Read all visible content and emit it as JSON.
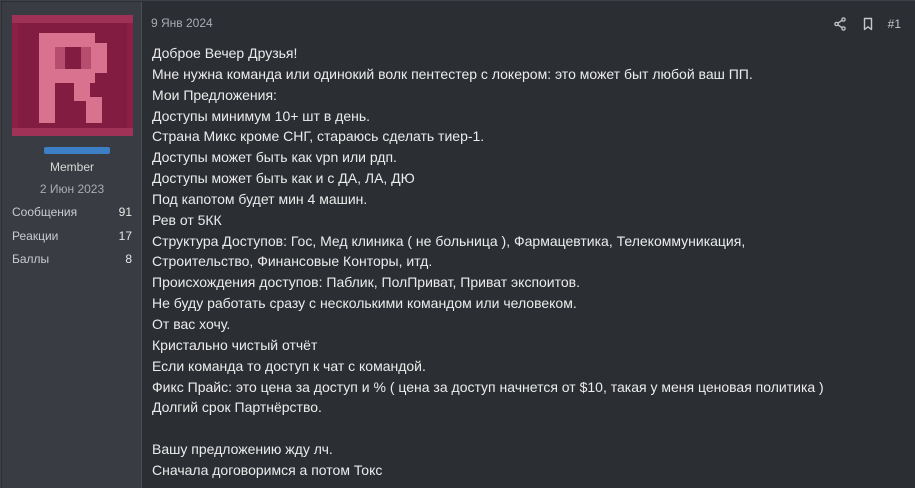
{
  "user": {
    "avatar_letter": "R",
    "title": "Member",
    "joined": "2 Июн 2023",
    "stats": [
      {
        "label": "Сообщения",
        "value": "91"
      },
      {
        "label": "Реакции",
        "value": "17"
      },
      {
        "label": "Баллы",
        "value": "8"
      }
    ]
  },
  "post": {
    "date": "9 Янв 2024",
    "number": "#1",
    "lines": [
      "Доброе Вечер Друзья!",
      "Мне нужна команда или одинокий волк пентестер с локером: это может быт любой ваш ПП.",
      "Мои Предложения:",
      "Доступы минимум 10+ шт в день.",
      "Страна Микс кроме СНГ, стараюсь сделать тиер-1.",
      "Доступы может быть как vpn или рдп.",
      "Доступы может быть как и с ДА, ЛА, ДЮ",
      "Под капотом будет мин 4 машин.",
      "Рев от 5КК",
      "Структура Доступов: Гос, Мед клиника ( не больница ), Фармацевтика, Телекоммуникация,",
      "Строительство, Финансовые Конторы, итд.",
      "Происхождения доступов: Паблик, ПолПриват, Приват экспоитов.",
      "Не буду работать сразу с несколькими командом или человеком.",
      "От вас хочу.",
      "Кристально чистый отчёт",
      "Если команда то доступ к чат с командой.",
      "Фикс Прайс: это цена за доступ и % ( цена за доступ начнется от $10, такая у меня ценовая политика )",
      "Долгий срок Партнёрство.",
      "",
      "Вашу предложению жду лч.",
      "Сначала договоримся а потом Токс"
    ]
  },
  "colors": {
    "avatar_bg": "#8b1f45",
    "avatar_letter": "#d9728f",
    "banner": "#3c7fc4",
    "panel_bg": "#393c42",
    "main_bg": "#2b2e33"
  },
  "icons": [
    "share-icon",
    "bookmark-icon"
  ]
}
